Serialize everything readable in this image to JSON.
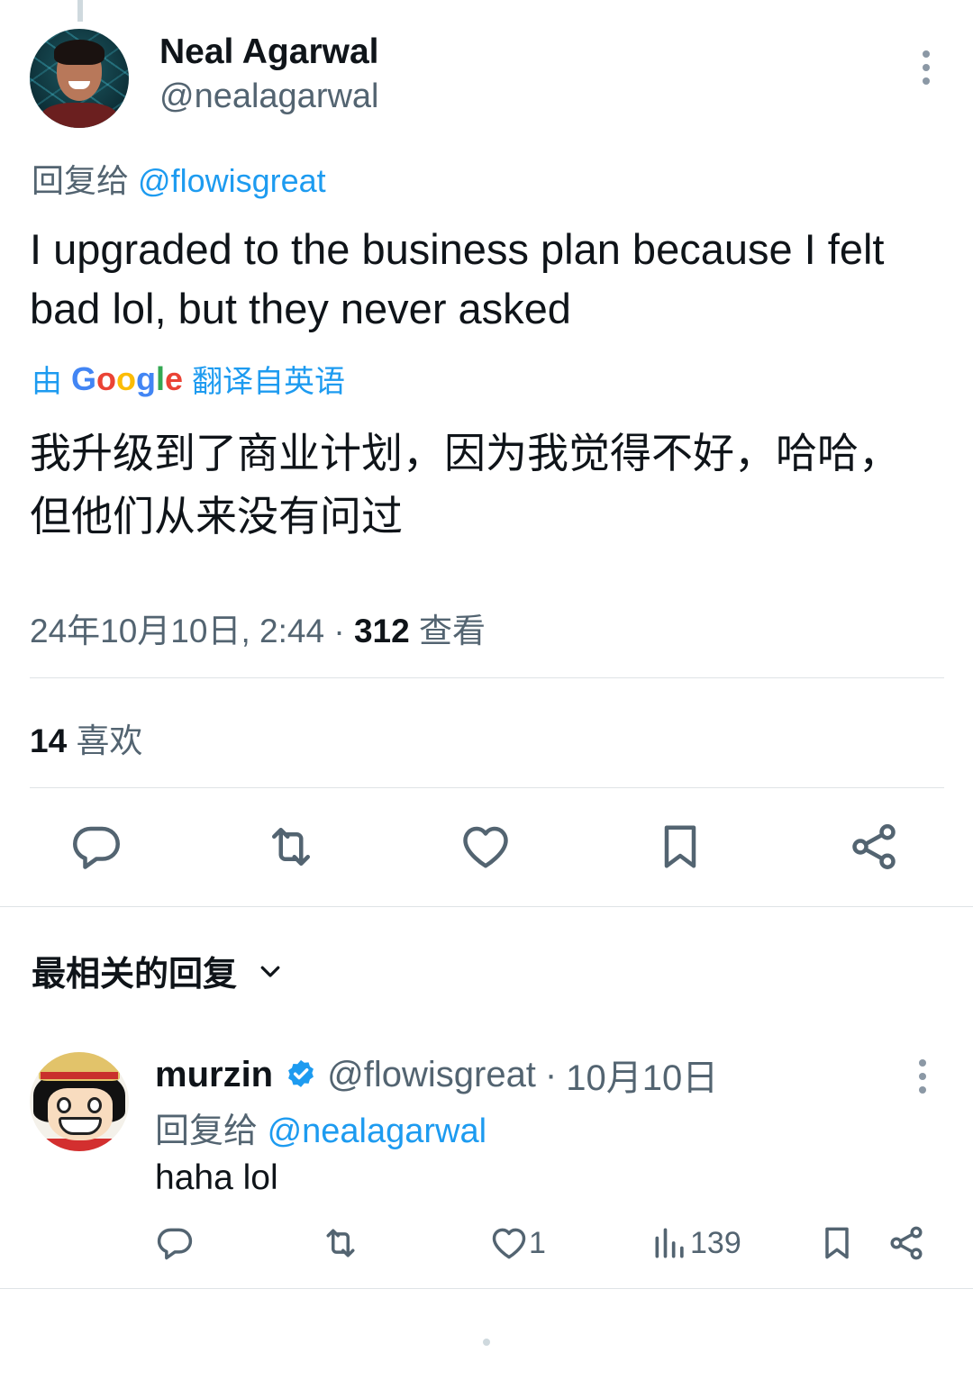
{
  "main_tweet": {
    "author_name": "Neal Agarwal",
    "author_handle": "@nealagarwal",
    "reply_prefix": "回复给",
    "reply_mention": "@flowisgreat",
    "text": "I upgraded to the business plan because I felt bad lol, but they never asked",
    "translate_prefix": "由",
    "translate_brand": "Google",
    "translate_suffix": "翻译自英语",
    "translated_text": "我升级到了商业计划，因为我觉得不好，哈哈，但他们从来没有问过",
    "timestamp": "24年10月10日, 2:44",
    "separator": "·",
    "views_count": "312",
    "views_label": "查看",
    "likes_count": "14",
    "likes_label": "喜欢"
  },
  "replies_section": {
    "sort_label": "最相关的回复"
  },
  "reply": {
    "author_name": "murzin",
    "author_handle": "@flowisgreat",
    "separator": "·",
    "date": "10月10日",
    "reply_prefix": "回复给",
    "reply_mention": "@nealagarwal",
    "text": "haha lol",
    "like_count": "1",
    "view_count": "139"
  },
  "icons": {
    "reply": "reply-icon",
    "retweet": "retweet-icon",
    "like": "heart-icon",
    "bookmark": "bookmark-icon",
    "share": "share-icon",
    "views": "views-bar-icon",
    "verified": "verified-badge-icon",
    "more": "more-dots-icon",
    "chevron": "chevron-down-icon"
  },
  "colors": {
    "text": "#0f1419",
    "secondary": "#536471",
    "accent": "#1d9bf0",
    "divider": "#dfe3e6"
  }
}
